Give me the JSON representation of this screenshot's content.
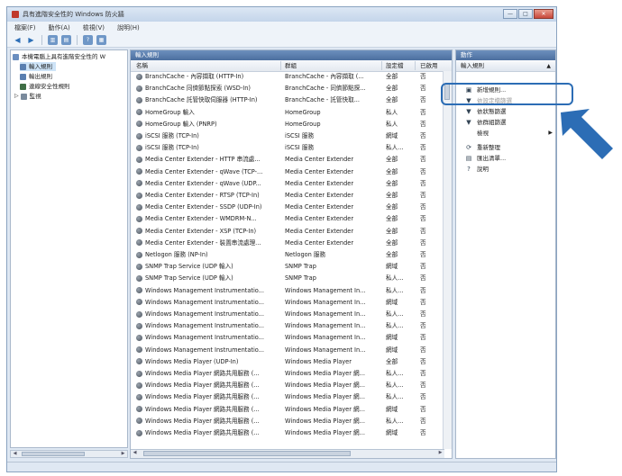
{
  "window": {
    "title": "具有進階安全性的 Windows 防火牆",
    "buttons": [
      "—",
      "□",
      "✕"
    ]
  },
  "menu": [
    "檔案(F)",
    "動作(A)",
    "檢視(V)",
    "說明(H)"
  ],
  "tree": {
    "root": "本機電腦上具有進階安全性的 W",
    "items": [
      "輸入規則",
      "輸出規則",
      "連線安全性規則",
      "監視"
    ]
  },
  "center": {
    "header": "輸入規則",
    "columns": [
      "名稱",
      "群組",
      "設定檔",
      "已啟用"
    ],
    "rows": [
      [
        "BranchCache - 內容擷取 (HTTP-In)",
        "BranchCache - 內容擷取 (...",
        "全部",
        "否"
      ],
      [
        "BranchCache 同儕節點探索 (WSD-In)",
        "BranchCache - 同儕節點探...",
        "全部",
        "否"
      ],
      [
        "BranchCache 託管快取伺服器 (HTTP-In)",
        "BranchCache - 託管快取...",
        "全部",
        "否"
      ],
      [
        "HomeGroup 輸入",
        "HomeGroup",
        "私人",
        "否"
      ],
      [
        "HomeGroup 輸入 (PNRP)",
        "HomeGroup",
        "私人",
        "否"
      ],
      [
        "iSCSI 服務 (TCP-In)",
        "iSCSI 服務",
        "網域",
        "否"
      ],
      [
        "iSCSI 服務 (TCP-In)",
        "iSCSI 服務",
        "私人...",
        "否"
      ],
      [
        "Media Center Extender - HTTP 串流處...",
        "Media Center Extender",
        "全部",
        "否"
      ],
      [
        "Media Center Extender - qWave (TCP-...",
        "Media Center Extender",
        "全部",
        "否"
      ],
      [
        "Media Center Extender - qWave (UDP...",
        "Media Center Extender",
        "全部",
        "否"
      ],
      [
        "Media Center Extender - RTSP (TCP-In)",
        "Media Center Extender",
        "全部",
        "否"
      ],
      [
        "Media Center Extender - SSDP (UDP-In)",
        "Media Center Extender",
        "全部",
        "否"
      ],
      [
        "Media Center Extender - WMDRM-N...",
        "Media Center Extender",
        "全部",
        "否"
      ],
      [
        "Media Center Extender - XSP (TCP-In)",
        "Media Center Extender",
        "全部",
        "否"
      ],
      [
        "Media Center Extender - 裝置串流處理...",
        "Media Center Extender",
        "全部",
        "否"
      ],
      [
        "Netlogon 服務 (NP-In)",
        "Netlogon 服務",
        "全部",
        "否"
      ],
      [
        "SNMP Trap Service (UDP 輸入)",
        "SNMP Trap",
        "網域",
        "否"
      ],
      [
        "SNMP Trap Service (UDP 輸入)",
        "SNMP Trap",
        "私人...",
        "否"
      ],
      [
        "Windows Management Instrumentatio...",
        "Windows Management In...",
        "私人...",
        "否"
      ],
      [
        "Windows Management Instrumentatio...",
        "Windows Management In...",
        "網域",
        "否"
      ],
      [
        "Windows Management Instrumentatio...",
        "Windows Management In...",
        "私人...",
        "否"
      ],
      [
        "Windows Management Instrumentatio...",
        "Windows Management In...",
        "私人...",
        "否"
      ],
      [
        "Windows Management Instrumentatio...",
        "Windows Management In...",
        "網域",
        "否"
      ],
      [
        "Windows Management Instrumentatio...",
        "Windows Management In...",
        "網域",
        "否"
      ],
      [
        "Windows Media Player (UDP-In)",
        "Windows Media Player",
        "全部",
        "否"
      ],
      [
        "Windows Media Player 網路共用服務 (...",
        "Windows Media Player 網...",
        "私人...",
        "否"
      ],
      [
        "Windows Media Player 網路共用服務 (...",
        "Windows Media Player 網...",
        "私人...",
        "否"
      ],
      [
        "Windows Media Player 網路共用服務 (...",
        "Windows Media Player 網...",
        "私人...",
        "否"
      ],
      [
        "Windows Media Player 網路共用服務 (...",
        "Windows Media Player 網...",
        "網域",
        "否"
      ],
      [
        "Windows Media Player 網路共用服務 (...",
        "Windows Media Player 網...",
        "私人...",
        "否"
      ],
      [
        "Windows Media Player 網路共用服務 (...",
        "Windows Media Player 網...",
        "網域",
        "否"
      ]
    ]
  },
  "actions": {
    "header": "動作",
    "section": "輸入規則",
    "items": [
      {
        "icon": "new-rule-icon",
        "label": "新增規則...",
        "glyph": "▣"
      },
      {
        "icon": "filter-profile-icon",
        "label": "依設定檔篩選",
        "glyph": "▼"
      },
      {
        "icon": "filter-state-icon",
        "label": "依狀態篩選",
        "glyph": "▼"
      },
      {
        "icon": "filter-group-icon",
        "label": "依群組篩選",
        "glyph": "▼"
      },
      {
        "icon": "view-icon",
        "label": "檢視",
        "glyph": ""
      },
      {
        "icon": "refresh-icon",
        "label": "重新整理",
        "glyph": "⟳"
      },
      {
        "icon": "export-icon",
        "label": "匯出清單...",
        "glyph": "▤"
      },
      {
        "icon": "help-icon",
        "label": "說明",
        "glyph": "?"
      }
    ]
  },
  "colors": {
    "highlight": "#2c6db5",
    "arrow": "#2c6db5"
  }
}
